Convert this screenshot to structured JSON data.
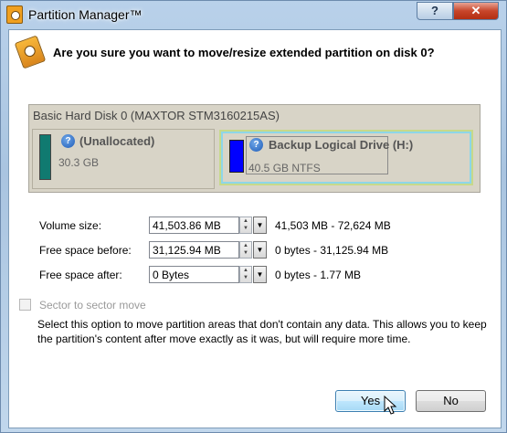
{
  "window": {
    "title": "Partition Manager™",
    "help_label": "?",
    "close_label": "✕"
  },
  "dialog": {
    "question": "Are you sure you want to move/resize extended partition on disk 0?"
  },
  "disk": {
    "title": "Basic Hard Disk 0 (MAXTOR STM3160215AS)",
    "partitions": [
      {
        "name": "(Unallocated)",
        "size": "30.3 GB",
        "color": "#107a70"
      },
      {
        "name": "Backup Logical Drive (H:)",
        "size": "40.5 GB NTFS",
        "color": "#0000ff"
      }
    ]
  },
  "fields": [
    {
      "label": "Volume size:",
      "value": "41,503.86 MB",
      "range": "41,503 MB - 72,624 MB"
    },
    {
      "label": "Free space before:",
      "value": "31,125.94 MB",
      "range": "0 bytes - 31,125.94 MB"
    },
    {
      "label": "Free space after:",
      "value": "0 Bytes",
      "range": "0 bytes - 1.77 MB"
    }
  ],
  "sector_move": {
    "label": "Sector to sector move",
    "checked": false,
    "description": "Select this option to move partition areas that don't contain any data. This allows you to keep the partition's content after move exactly as it was, but will require more time."
  },
  "buttons": {
    "yes": "Yes",
    "no": "No"
  },
  "icons": {
    "app": "partition-manager-icon",
    "question": "partition-manager-icon",
    "info": "help-info-icon"
  }
}
